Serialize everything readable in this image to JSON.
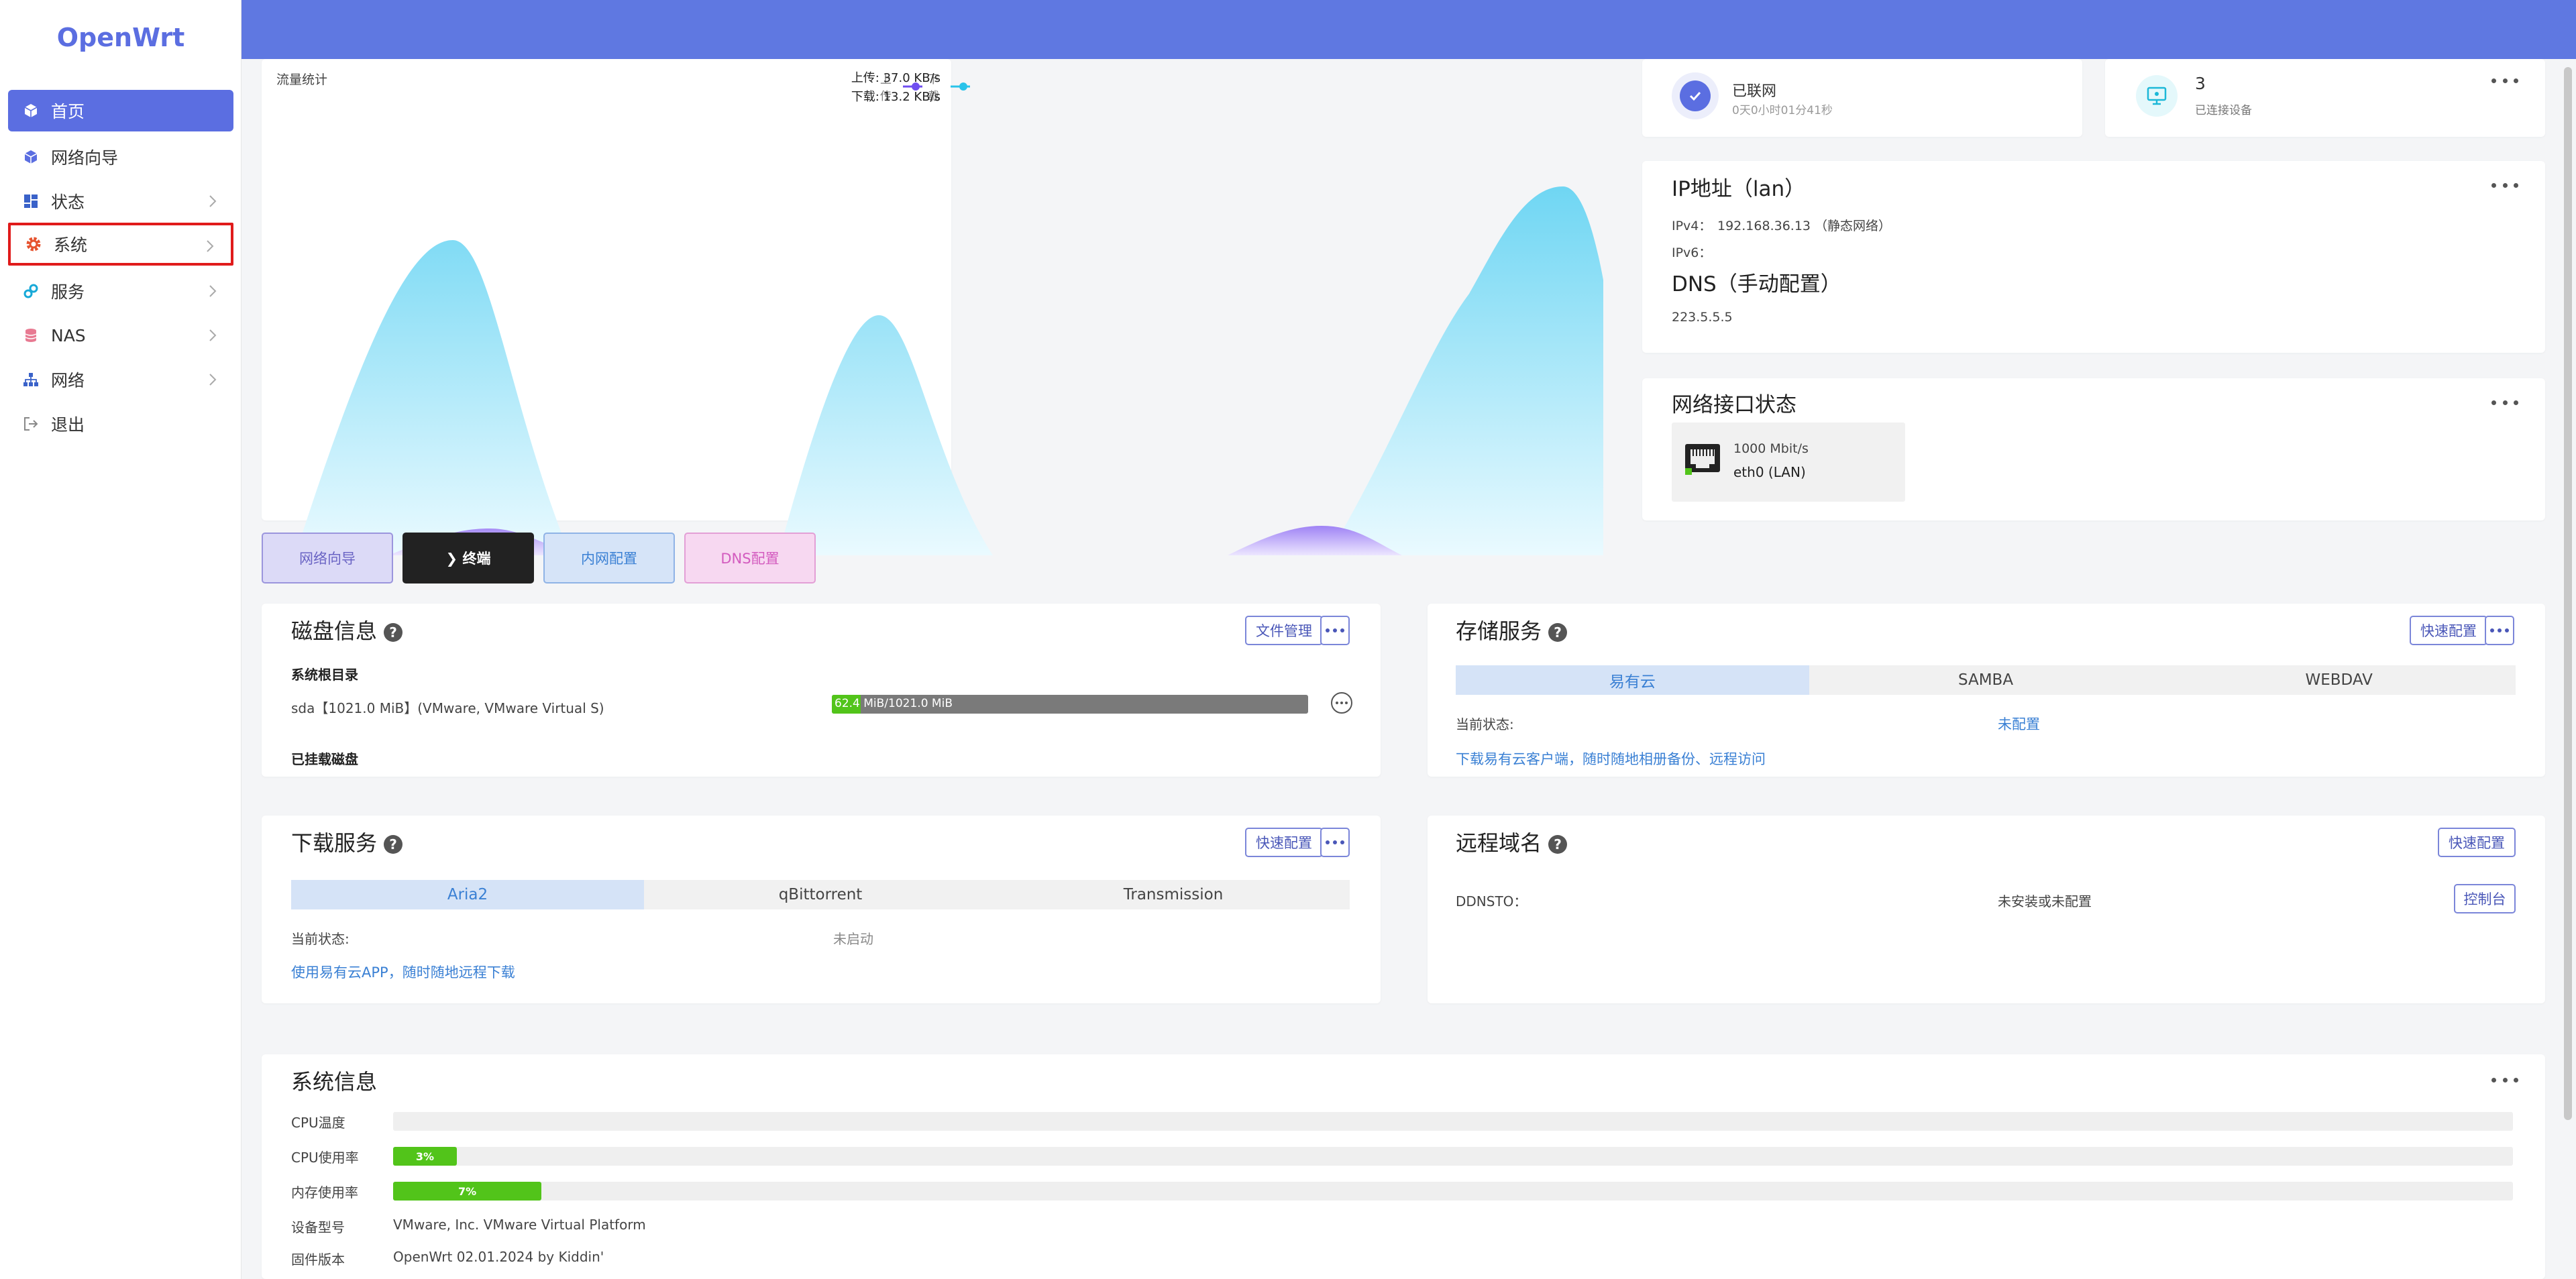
{
  "app": {
    "logo": "OpenWrt"
  },
  "sidebar": {
    "items": [
      {
        "label": "首页",
        "icon": "cube-icon"
      },
      {
        "label": "网络向导",
        "icon": "cube-icon"
      },
      {
        "label": "状态",
        "icon": "dashboard-icon"
      },
      {
        "label": "系统",
        "icon": "gear-icon"
      },
      {
        "label": "服务",
        "icon": "link-icon"
      },
      {
        "label": "NAS",
        "icon": "database-icon"
      },
      {
        "label": "网络",
        "icon": "network-icon"
      },
      {
        "label": "退出",
        "icon": "logout-icon"
      }
    ]
  },
  "traffic": {
    "title": "流量统计",
    "legend_upload": "上传",
    "legend_download": "下载",
    "upload_rate": "上传: 37.0 KB/s",
    "download_rate": "下载: 13.2 KB/s",
    "colors": {
      "upload": "#6f4ef0",
      "download": "#29c3ea"
    }
  },
  "status_cards": {
    "online": {
      "title": "已联网",
      "subtitle": "0天0小时01分41秒"
    },
    "devices": {
      "count": "3",
      "subtitle": "已连接设备"
    }
  },
  "ip_card": {
    "title": "IP地址（lan）",
    "ipv4_label": "IPv4：",
    "ipv4_value": "192.168.36.13 （静态网络）",
    "ipv6_label": "IPv6：",
    "dns_title": "DNS（手动配置）",
    "dns_value": "223.5.5.5"
  },
  "iface_card": {
    "title": "网络接口状态",
    "speed": "1000 Mbit/s",
    "name": "eth0 (LAN)"
  },
  "quick_buttons": [
    {
      "label": "网络向导"
    },
    {
      "label": "❯ 终端"
    },
    {
      "label": "内网配置"
    },
    {
      "label": "DNS配置"
    }
  ],
  "disk": {
    "title": "磁盘信息",
    "file_btn": "文件管理",
    "root_label": "系统根目录",
    "device": "sda【1021.0 MiB】(VMware, VMware Virtual S)",
    "usage_text": "62.4 MiB/1021.0 MiB",
    "usage_fraction": 0.061,
    "mounted_label": "已挂载磁盘"
  },
  "storage": {
    "title": "存储服务",
    "quick_btn": "快速配置",
    "tabs": [
      "易有云",
      "SAMBA",
      "WEBDAV"
    ],
    "status_label": "当前状态:",
    "status_value": "未配置",
    "link": "下载易有云客户端，随时随地相册备份、远程访问"
  },
  "download": {
    "title": "下载服务",
    "quick_btn": "快速配置",
    "tabs": [
      "Aria2",
      "qBittorrent",
      "Transmission"
    ],
    "status_label": "当前状态:",
    "status_value": "未启动",
    "link": "使用易有云APP，随时随地远程下载"
  },
  "remote": {
    "title": "远程域名",
    "quick_btn": "快速配置",
    "ddnsto_label": "DDNSTO：",
    "ddnsto_value": "未安装或未配置",
    "console_btn": "控制台"
  },
  "sysinfo": {
    "title": "系统信息",
    "cpu_temp_label": "CPU温度",
    "cpu_usage_label": "CPU使用率",
    "cpu_usage_text": "3%",
    "cpu_usage_fraction": 0.03,
    "mem_usage_label": "内存使用率",
    "mem_usage_text": "7%",
    "mem_usage_fraction": 0.07,
    "model_label": "设备型号",
    "model_value": "VMware, Inc. VMware Virtual Platform",
    "firmware_label": "固件版本",
    "firmware_value": "OpenWrt 02.01.2024 by Kiddin'"
  }
}
